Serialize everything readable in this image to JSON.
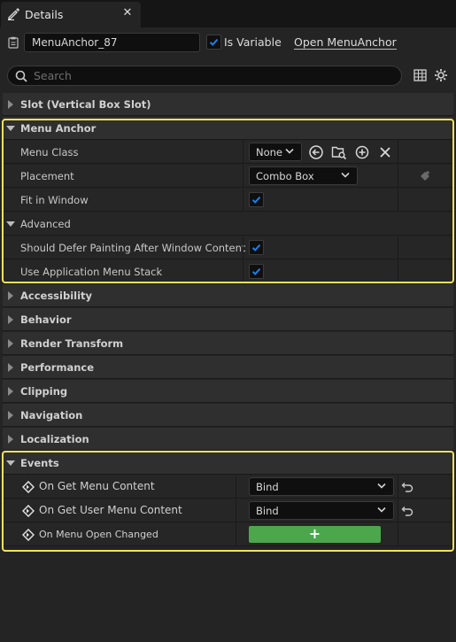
{
  "tab": {
    "title": "Details",
    "close": "✕"
  },
  "header": {
    "name_value": "MenuAnchor_87",
    "is_variable_label": "Is Variable",
    "is_variable_checked": true,
    "open_link": "Open MenuAnchor"
  },
  "search": {
    "placeholder": "Search"
  },
  "sections": {
    "slot": "Slot (Vertical Box Slot)",
    "menu_anchor": "Menu Anchor",
    "accessibility": "Accessibility",
    "behavior": "Behavior",
    "render_transform": "Render Transform",
    "performance": "Performance",
    "clipping": "Clipping",
    "navigation": "Navigation",
    "localization": "Localization",
    "events": "Events"
  },
  "menu_anchor": {
    "menu_class_label": "Menu Class",
    "menu_class_value": "None",
    "placement_label": "Placement",
    "placement_value": "Combo Box",
    "fit_in_window_label": "Fit in Window",
    "fit_in_window_checked": true,
    "advanced_label": "Advanced",
    "defer_painting_label": "Should Defer Painting After Window Content",
    "defer_painting_checked": true,
    "use_app_menu_stack_label": "Use Application Menu Stack",
    "use_app_menu_stack_checked": true
  },
  "events": {
    "on_get_menu_content": {
      "label": "On Get Menu Content",
      "value": "Bind"
    },
    "on_get_user_menu_content": {
      "label": "On Get User Menu Content",
      "value": "Bind"
    },
    "on_menu_open_changed": {
      "label": "On Menu Open Changed",
      "button": "+"
    }
  },
  "colors": {
    "highlight": "#f2e35c",
    "accent_check": "#1e7ee6",
    "add_button": "#4ca74c"
  },
  "icons": [
    "pencil-icon",
    "close-icon",
    "clipboard-icon",
    "search-icon",
    "table-icon",
    "gear-icon",
    "back-arrow-icon",
    "browse-folder-icon",
    "add-circle-icon",
    "clear-icon",
    "reset-icon",
    "event-icon"
  ]
}
